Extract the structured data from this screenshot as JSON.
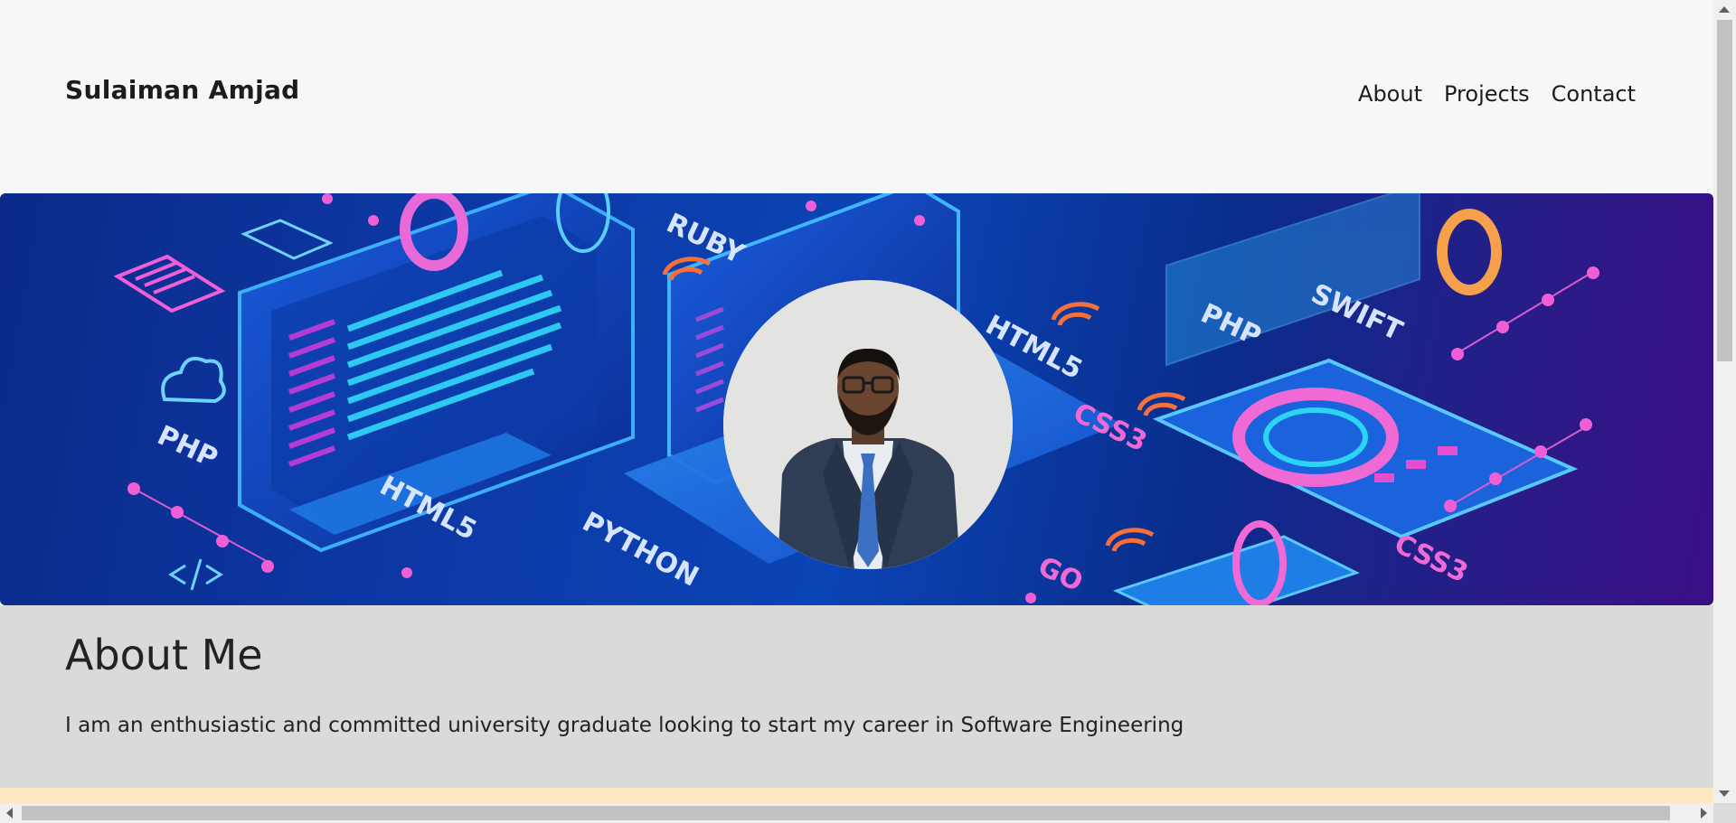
{
  "header": {
    "brand": "Sulaiman Amjad",
    "nav": [
      "About",
      "Projects",
      "Contact"
    ]
  },
  "hero": {
    "tech_labels": [
      "RUBY",
      "PHP",
      "HTML5",
      "PYTHON",
      "HTML5",
      "PHP",
      "SWIFT",
      "CSS3",
      "GO",
      "CSS3"
    ]
  },
  "about": {
    "heading": "About Me",
    "text": "I am an enthusiastic and committed university graduate looking to start my career in Software Engineering"
  },
  "colors": {
    "page_bg": "#f6f7f9",
    "about_bg": "#d9dbd8",
    "footer_strip": "#fde8c4",
    "hero_blue": "#0b44b5",
    "hero_purple": "#3b0f86"
  }
}
